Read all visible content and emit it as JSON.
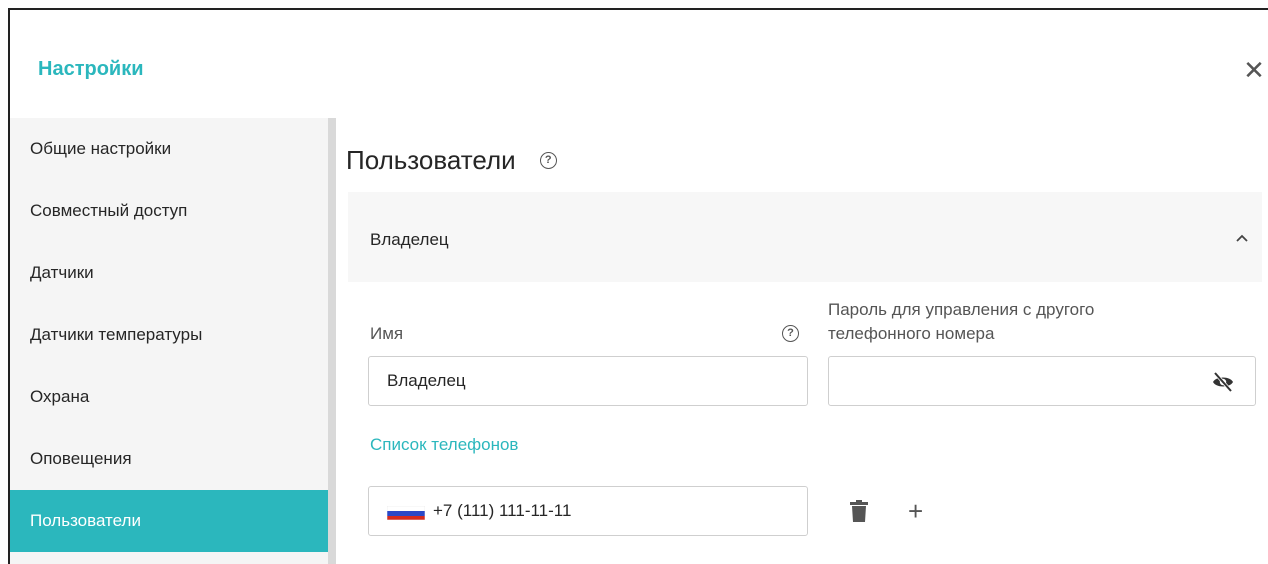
{
  "header": {
    "title": "Настройки",
    "close_icon": "close-icon"
  },
  "sidebar": {
    "items": [
      {
        "label": "Общие настройки"
      },
      {
        "label": "Совместный доступ"
      },
      {
        "label": "Датчики"
      },
      {
        "label": "Датчики температуры"
      },
      {
        "label": "Охрана"
      },
      {
        "label": "Оповещения"
      },
      {
        "label": "Пользователи",
        "active": true
      }
    ]
  },
  "main": {
    "title": "Пользователи",
    "help_glyph": "?",
    "section": {
      "title": "Владелец",
      "name_label": "Имя",
      "name_value": "Владелец",
      "password_label_line1": "Пароль для управления с другого",
      "password_label_line2": "телефонного номера",
      "password_value": "",
      "phones_title": "Список телефонов",
      "phone_value": "+7 (111) 111-11-11"
    }
  },
  "colors": {
    "accent": "#2bb7bd",
    "sidebar_bg": "#f5f5f5",
    "section_header_bg": "#f7f7f7"
  }
}
